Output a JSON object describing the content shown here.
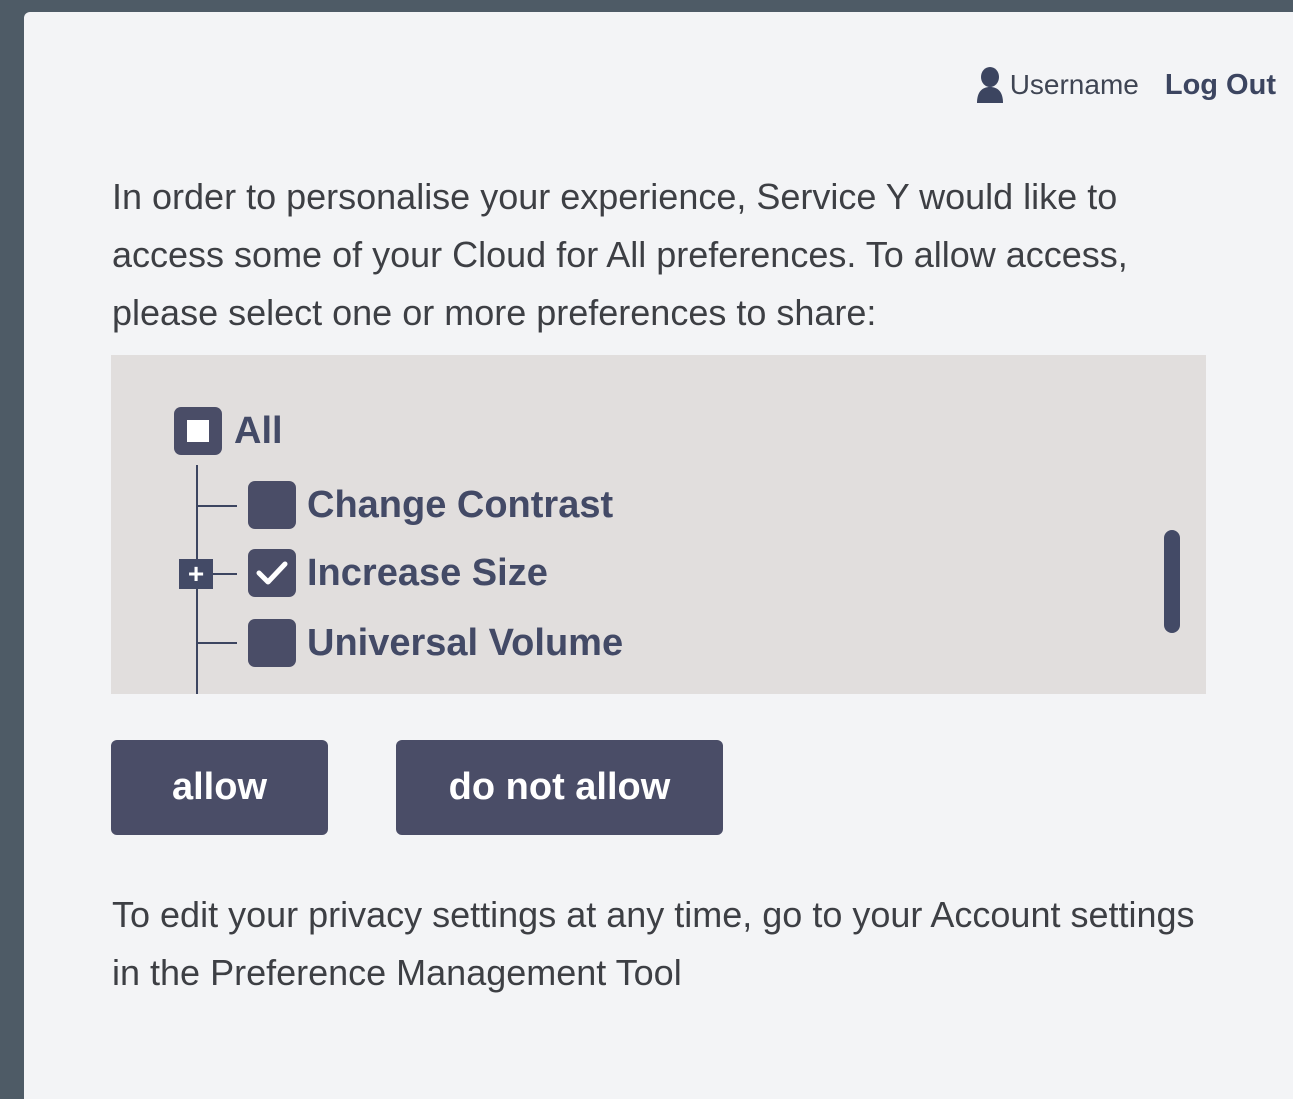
{
  "header": {
    "username": "Username",
    "logout_label": "Log Out"
  },
  "intro": {
    "text": "In order to personalise your experience, Service Y would like to access some of your Cloud for All preferences.  To allow access, please select one or more preferences to share:"
  },
  "preferences": {
    "root": {
      "label": "All",
      "state": "indeterminate"
    },
    "items": [
      {
        "label": "Change Contrast",
        "checked": false,
        "expandable": false
      },
      {
        "label": "Increase Size",
        "checked": true,
        "expandable": true
      },
      {
        "label": "Universal Volume",
        "checked": false,
        "expandable": false
      }
    ],
    "expander_label": "+"
  },
  "actions": {
    "allow_label": "allow",
    "deny_label": "do not allow"
  },
  "footer": {
    "text": "To edit your privacy settings at any time, go to your Account settings in the Preference Management Tool"
  },
  "colors": {
    "accent": "#4a4d67",
    "panel_background": "#f3f4f6",
    "tree_background": "#e1dedd",
    "page_background": "#4e5b66"
  }
}
